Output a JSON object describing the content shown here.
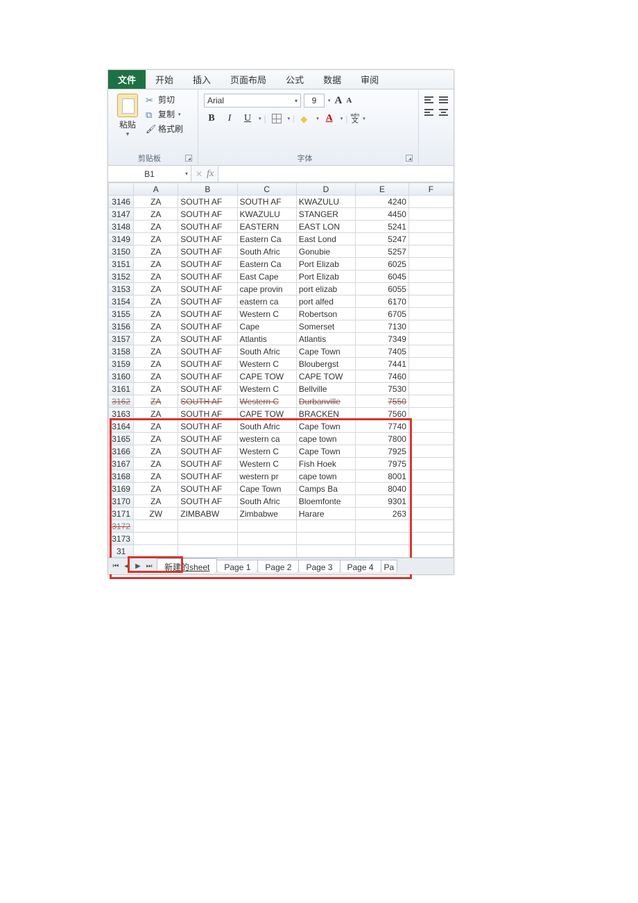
{
  "ribbon": {
    "tabs": {
      "file": "文件",
      "home": "开始",
      "insert": "插入",
      "layout": "页面布局",
      "formulas": "公式",
      "data": "数据",
      "review": "审阅"
    },
    "clipboard": {
      "paste": "粘贴",
      "cut": "剪切",
      "copy": "复制",
      "format_painter": "格式刷",
      "group_label": "剪贴板"
    },
    "font": {
      "name": "Arial",
      "size": "9",
      "bold": "B",
      "italic": "I",
      "underline": "U",
      "font_color_glyph": "A",
      "phonetic_top": "wén",
      "phonetic_bottom": "文",
      "group_label": "字体"
    }
  },
  "fxbar": {
    "namebox": "B1",
    "fx": "fx"
  },
  "columns": [
    "A",
    "B",
    "C",
    "D",
    "E",
    "F"
  ],
  "rows": [
    {
      "n": "3146",
      "a": "ZA",
      "b": "SOUTH AF",
      "c": "SOUTH AF",
      "d": "KWAZULU",
      "e": "4240"
    },
    {
      "n": "3147",
      "a": "ZA",
      "b": "SOUTH AF",
      "c": "KWAZULU",
      "d": "STANGER",
      "e": "4450"
    },
    {
      "n": "3148",
      "a": "ZA",
      "b": "SOUTH AF",
      "c": "EASTERN",
      "d": "EAST LON",
      "e": "5241"
    },
    {
      "n": "3149",
      "a": "ZA",
      "b": "SOUTH AF",
      "c": "Eastern Ca",
      "d": "East Lond",
      "e": "5247"
    },
    {
      "n": "3150",
      "a": "ZA",
      "b": "SOUTH AF",
      "c": "South Afric",
      "d": "Gonubie",
      "e": "5257"
    },
    {
      "n": "3151",
      "a": "ZA",
      "b": "SOUTH AF",
      "c": "Eastern Ca",
      "d": "Port Elizab",
      "e": "6025"
    },
    {
      "n": "3152",
      "a": "ZA",
      "b": "SOUTH AF",
      "c": "East Cape",
      "d": "Port Elizab",
      "e": "6045"
    },
    {
      "n": "3153",
      "a": "ZA",
      "b": "SOUTH AF",
      "c": "cape provin",
      "d": "port elizab",
      "e": "6055"
    },
    {
      "n": "3154",
      "a": "ZA",
      "b": "SOUTH AF",
      "c": "eastern ca",
      "d": "port alfed",
      "e": "6170"
    },
    {
      "n": "3155",
      "a": "ZA",
      "b": "SOUTH AF",
      "c": "Western C",
      "d": "Robertson",
      "e": "6705"
    },
    {
      "n": "3156",
      "a": "ZA",
      "b": "SOUTH AF",
      "c": "Cape",
      "d": "Somerset",
      "e": "7130"
    },
    {
      "n": "3157",
      "a": "ZA",
      "b": "SOUTH AF",
      "c": "Atlantis",
      "d": "Atlantis",
      "e": "7349"
    },
    {
      "n": "3158",
      "a": "ZA",
      "b": "SOUTH AF",
      "c": "South Afric",
      "d": "Cape Town",
      "e": "7405"
    },
    {
      "n": "3159",
      "a": "ZA",
      "b": "SOUTH AF",
      "c": "Western C",
      "d": "Bloubergst",
      "e": "7441"
    },
    {
      "n": "3160",
      "a": "ZA",
      "b": "SOUTH AF",
      "c": "CAPE TOW",
      "d": "CAPE TOW",
      "e": "7460"
    },
    {
      "n": "3161",
      "a": "ZA",
      "b": "SOUTH AF",
      "c": "Western C",
      "d": "Bellville",
      "e": "7530"
    },
    {
      "n": "3162",
      "a": "ZA",
      "b": "SOUTH AF",
      "c": "Western C",
      "d": "Durbanville",
      "e": "7550",
      "struck": true
    },
    {
      "n": "3163",
      "a": "ZA",
      "b": "SOUTH AF",
      "c": "CAPE TOW",
      "d": "BRACKEN",
      "e": "7560"
    },
    {
      "n": "3164",
      "a": "ZA",
      "b": "SOUTH AF",
      "c": "South Afric",
      "d": "Cape Town",
      "e": "7740"
    },
    {
      "n": "3165",
      "a": "ZA",
      "b": "SOUTH AF",
      "c": "western ca",
      "d": "cape town",
      "e": "7800"
    },
    {
      "n": "3166",
      "a": "ZA",
      "b": "SOUTH AF",
      "c": "Western C",
      "d": "Cape Town",
      "e": "7925"
    },
    {
      "n": "3167",
      "a": "ZA",
      "b": "SOUTH AF",
      "c": "Western C",
      "d": "Fish Hoek",
      "e": "7975"
    },
    {
      "n": "3168",
      "a": "ZA",
      "b": "SOUTH AF",
      "c": "western pr",
      "d": "cape town",
      "e": "8001"
    },
    {
      "n": "3169",
      "a": "ZA",
      "b": "SOUTH AF",
      "c": "Cape Town",
      "d": "Camps Ba",
      "e": "8040"
    },
    {
      "n": "3170",
      "a": "ZA",
      "b": "SOUTH AF",
      "c": "South Afric",
      "d": "Bloemfonte",
      "e": "9301"
    },
    {
      "n": "3171",
      "a": "ZW",
      "b": "ZIMBABW",
      "c": "Zimbabwe",
      "d": "Harare",
      "e": "263"
    },
    {
      "n": "3172",
      "a": "",
      "b": "",
      "c": "",
      "d": "",
      "e": "",
      "struck": true
    },
    {
      "n": "3173",
      "a": "",
      "b": "",
      "c": "",
      "d": "",
      "e": ""
    },
    {
      "n": "31",
      "a": "",
      "b": "",
      "c": "",
      "d": "",
      "e": ""
    }
  ],
  "sheettabs": {
    "s1": "新建的sheet",
    "s2": "Page 1",
    "s3": "Page 2",
    "s4": "Page 3",
    "s5": "Page 4",
    "more": "Pa"
  }
}
